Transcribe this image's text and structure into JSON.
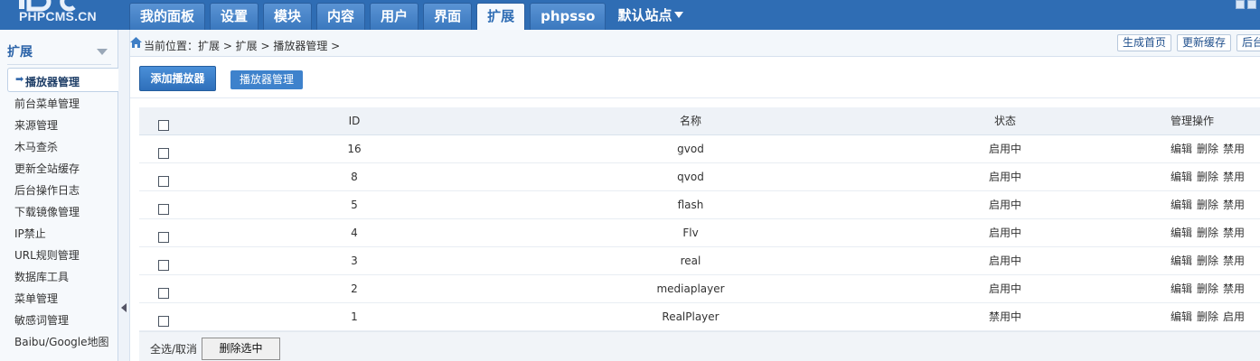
{
  "header": {
    "logo_text": "PHPCMS.CN",
    "tabs": [
      {
        "label": "我的面板",
        "active": false
      },
      {
        "label": "设置",
        "active": false
      },
      {
        "label": "模块",
        "active": false
      },
      {
        "label": "内容",
        "active": false
      },
      {
        "label": "用户",
        "active": false
      },
      {
        "label": "界面",
        "active": false
      },
      {
        "label": "扩展",
        "active": true
      },
      {
        "label": "phpsso",
        "active": false
      }
    ],
    "site_selector": "默认站点"
  },
  "sidebar": {
    "title": "扩展",
    "current": "播放器管理",
    "items": [
      "前台菜单管理",
      "来源管理",
      "木马查杀",
      "更新全站缓存",
      "后台操作日志",
      "下载镜像管理",
      "IP禁止",
      "URL规则管理",
      "数据库工具",
      "菜单管理",
      "敏感词管理",
      "Baibu/Google地图"
    ]
  },
  "breadcrumb": {
    "text": "当前位置：扩展 > 扩展 > 播放器管理 >",
    "buttons": [
      "生成首页",
      "更新缓存",
      "后台"
    ]
  },
  "actions": {
    "add_label": "添加播放器",
    "manage_label": "播放器管理"
  },
  "table": {
    "headers": {
      "id": "ID",
      "name": "名称",
      "status": "状态",
      "ops": "管理操作"
    },
    "rows": [
      {
        "id": "16",
        "name": "gvod",
        "status": "启用中",
        "ops": [
          "编辑",
          "删除",
          "禁用"
        ]
      },
      {
        "id": "8",
        "name": "qvod",
        "status": "启用中",
        "ops": [
          "编辑",
          "删除",
          "禁用"
        ]
      },
      {
        "id": "5",
        "name": "flash",
        "status": "启用中",
        "ops": [
          "编辑",
          "删除",
          "禁用"
        ]
      },
      {
        "id": "4",
        "name": "Flv",
        "status": "启用中",
        "ops": [
          "编辑",
          "删除",
          "禁用"
        ]
      },
      {
        "id": "3",
        "name": "real",
        "status": "启用中",
        "ops": [
          "编辑",
          "删除",
          "禁用"
        ]
      },
      {
        "id": "2",
        "name": "mediaplayer",
        "status": "启用中",
        "ops": [
          "编辑",
          "删除",
          "禁用"
        ]
      },
      {
        "id": "1",
        "name": "RealPlayer",
        "status": "禁用中",
        "ops": [
          "编辑",
          "删除",
          "启用"
        ]
      }
    ]
  },
  "footer": {
    "select_all": "全选/取消",
    "delete_selected": "删除选中"
  },
  "colors": {
    "header_bg": "#2f6db4",
    "accent": "#3e82cc",
    "sidebar_bg": "#f6f9fc"
  }
}
